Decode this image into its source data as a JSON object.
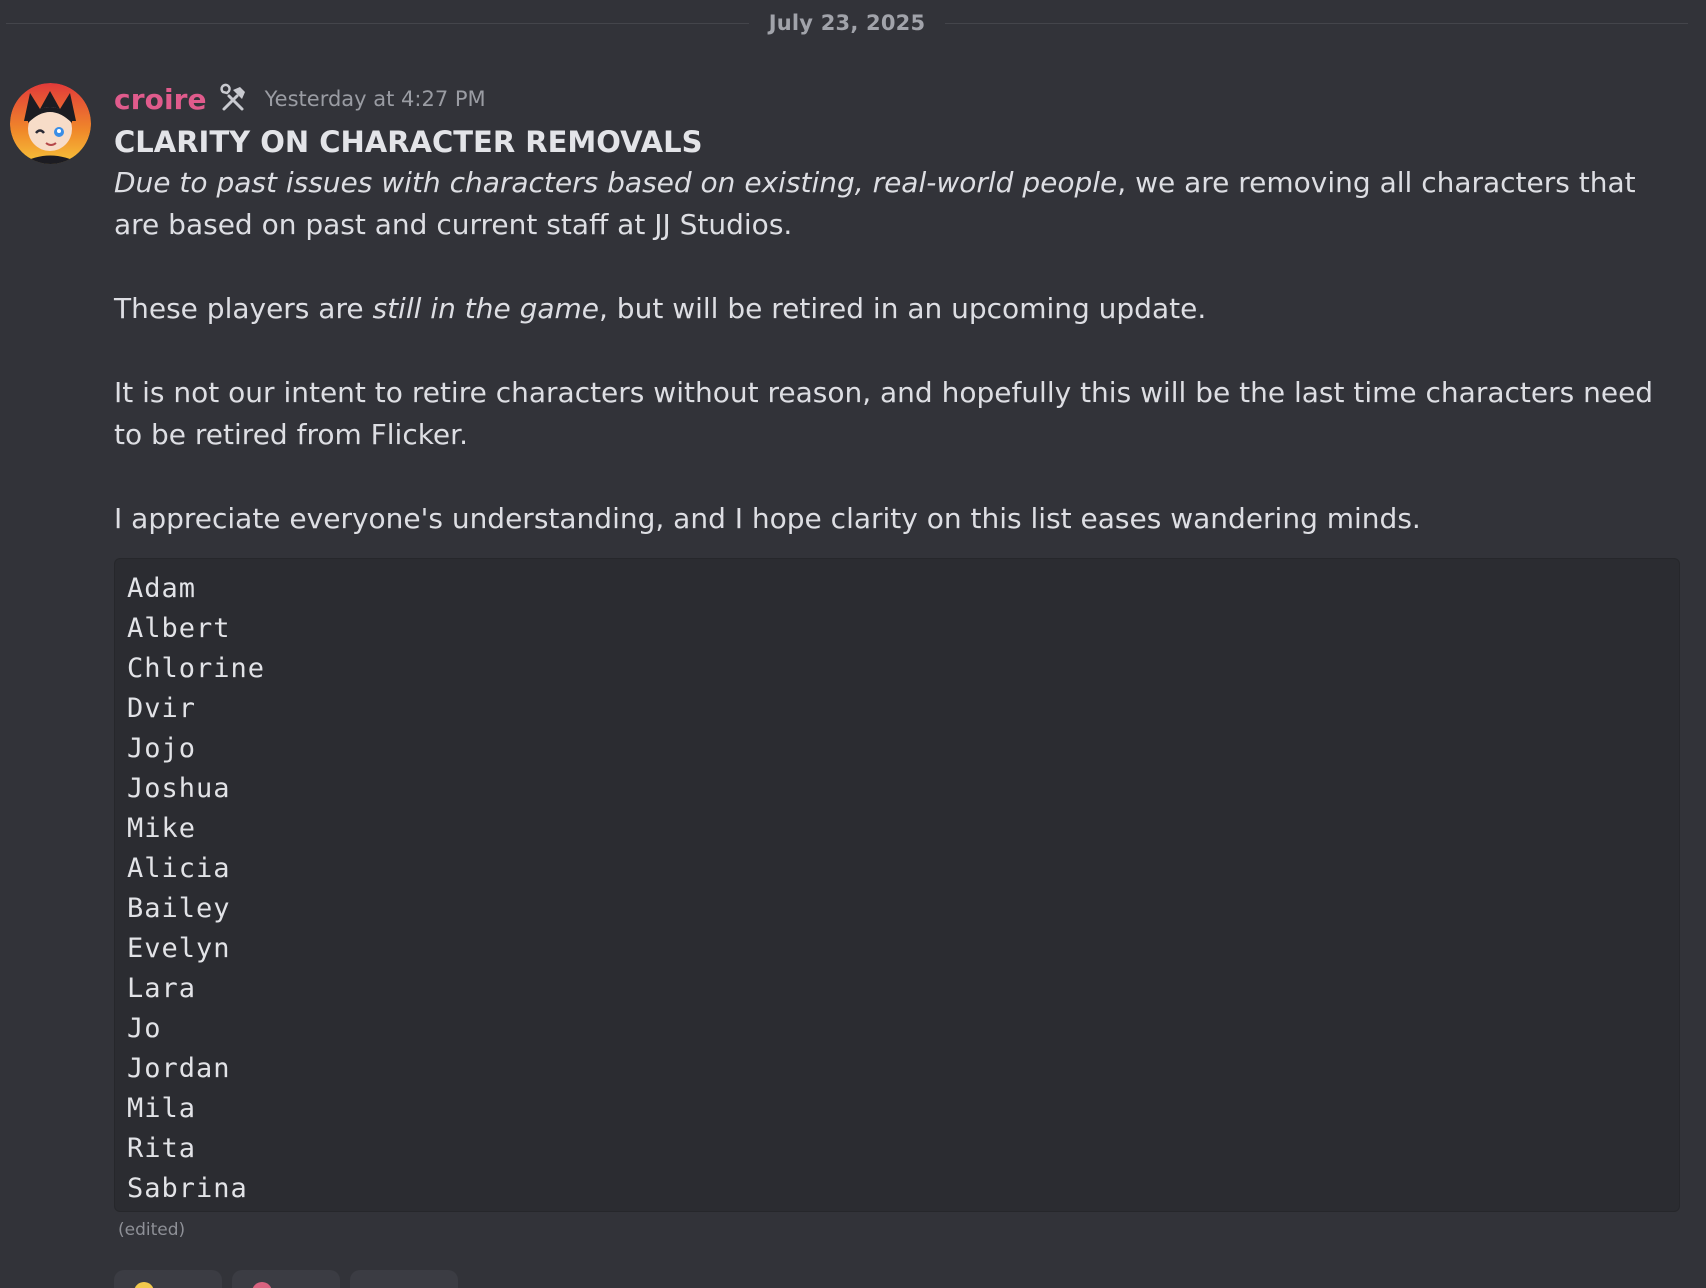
{
  "divider": {
    "date": "July 23, 2025"
  },
  "message": {
    "author": "croire",
    "role_icon": "hammer-wrench-icon",
    "timestamp": "Yesterday at 4:27 PM",
    "title": "CLARITY ON CHARACTER REMOVALS",
    "p1_italic": "Due to past issues with characters based on existing, real-world people",
    "p1_rest": ", we are removing all characters that are based on past and current staff at JJ Studios.",
    "p2_start": "These players are ",
    "p2_italic": "still in the game",
    "p2_end": ", but will be retired in an upcoming update.",
    "p3": "It is not our intent to retire characters without reason, and hopefully this will be the last time characters need to be retired from Flicker.",
    "p4": "I appreciate everyone's understanding, and I hope clarity on this list eases wandering minds.",
    "code_lines": [
      "Adam",
      "Albert",
      "Chlorine",
      "Dvir",
      "Jojo",
      "Joshua",
      "Mike",
      "Alicia",
      "Bailey",
      "Evelyn",
      "Lara",
      "Jo",
      "Jordan",
      "Mila",
      "Rita",
      "Sabrina"
    ],
    "edited": "(edited)"
  },
  "colors": {
    "background": "#323339",
    "username": "#e05b8c",
    "codeblock": "#2b2c31"
  }
}
